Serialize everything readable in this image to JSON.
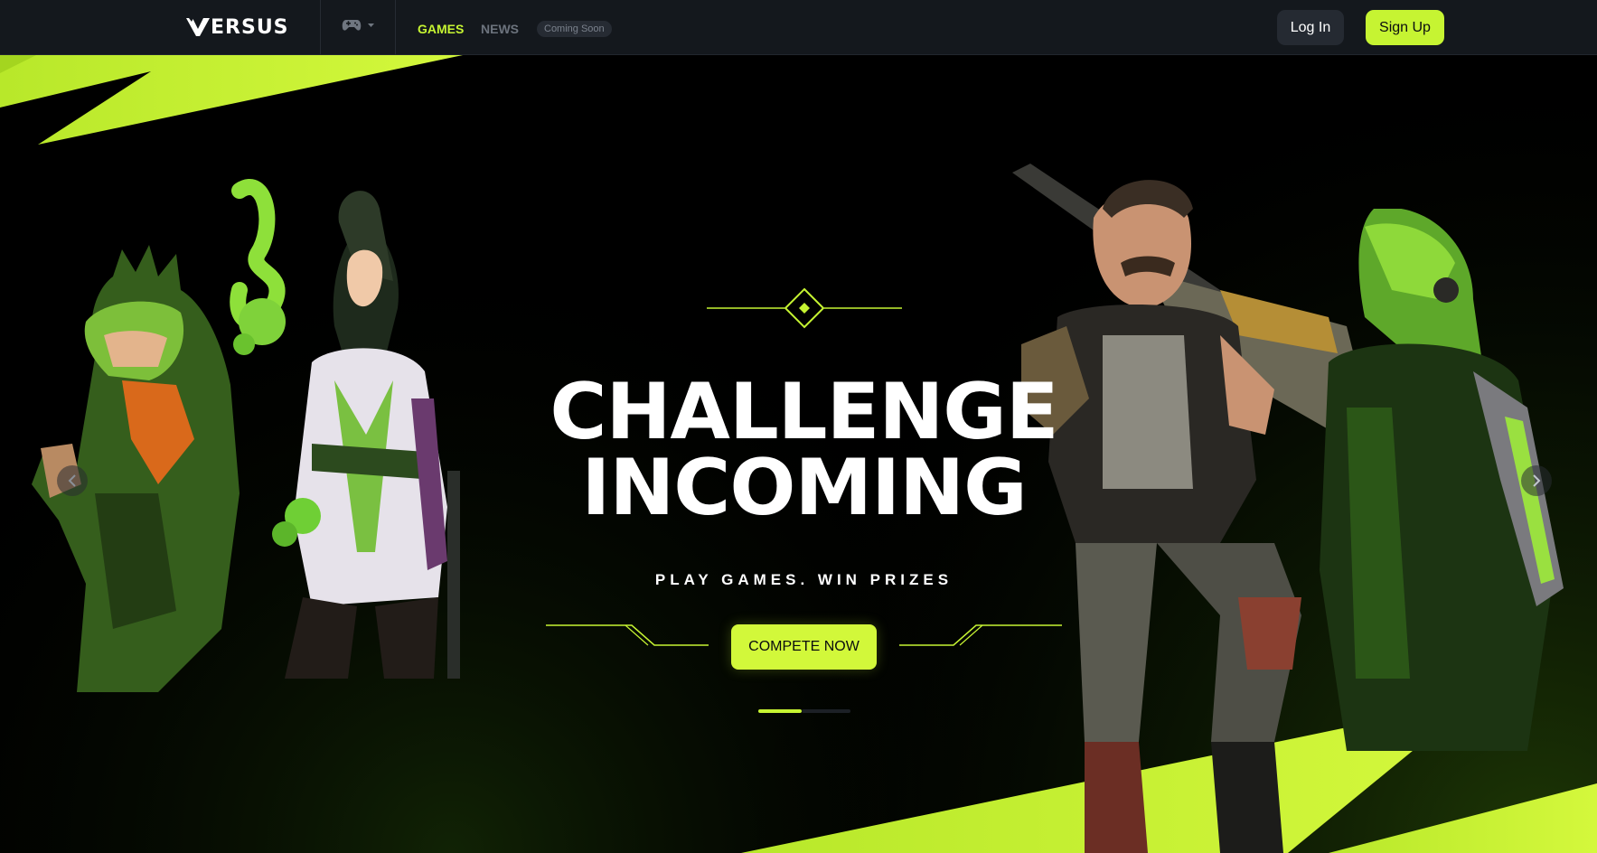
{
  "header": {
    "logo_text": "ERSUS",
    "game_icon": "gamepad-icon",
    "nav": {
      "games": "GAMES",
      "news": "NEWS",
      "coming_soon": "Coming Soon"
    },
    "login_label": "Log In",
    "signup_label": "Sign Up"
  },
  "hero": {
    "title_line1": "CHALLENGE",
    "title_line2": "INCOMING",
    "subtitle": "PLAY GAMES. WIN PRIZES",
    "cta_label": "COMPETE NOW",
    "carousel_slides": 2,
    "carousel_active": 1
  },
  "colors": {
    "accent": "#c6f432",
    "nav_bg": "#14181d",
    "hero_bg": "#000000"
  },
  "icons": [
    "gamepad-icon",
    "chevron-down-icon",
    "chevron-left-icon",
    "chevron-right-icon",
    "diamond-icon"
  ]
}
